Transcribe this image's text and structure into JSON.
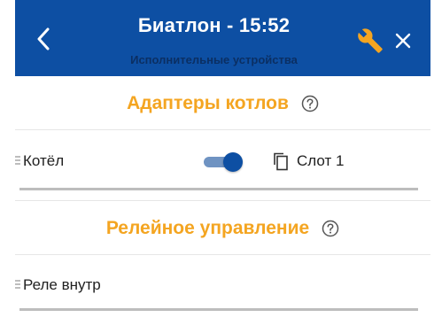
{
  "header": {
    "title": "Биатлон - 15:52",
    "subtitle": "Исполнительные устройства",
    "bg_color": "#0d4fa3",
    "back_icon": "chevron-left-icon",
    "settings_icon": "wrench-icon",
    "close_icon": "close-icon"
  },
  "sections": [
    {
      "title": "Адаптеры котлов",
      "help_icon": "help-circle-icon",
      "rows": [
        {
          "label": "Котёл",
          "toggle_on": true,
          "slot_label": "Слот 1",
          "slot_icon": "copy-icon"
        }
      ]
    },
    {
      "title": "Релейное управление",
      "help_icon": "help-circle-icon",
      "rows": [
        {
          "label": "Реле внутр"
        }
      ]
    }
  ],
  "colors": {
    "accent": "#f4a521",
    "toggle_on": "#0d4fa3",
    "toggle_track": "#6f93c2"
  }
}
